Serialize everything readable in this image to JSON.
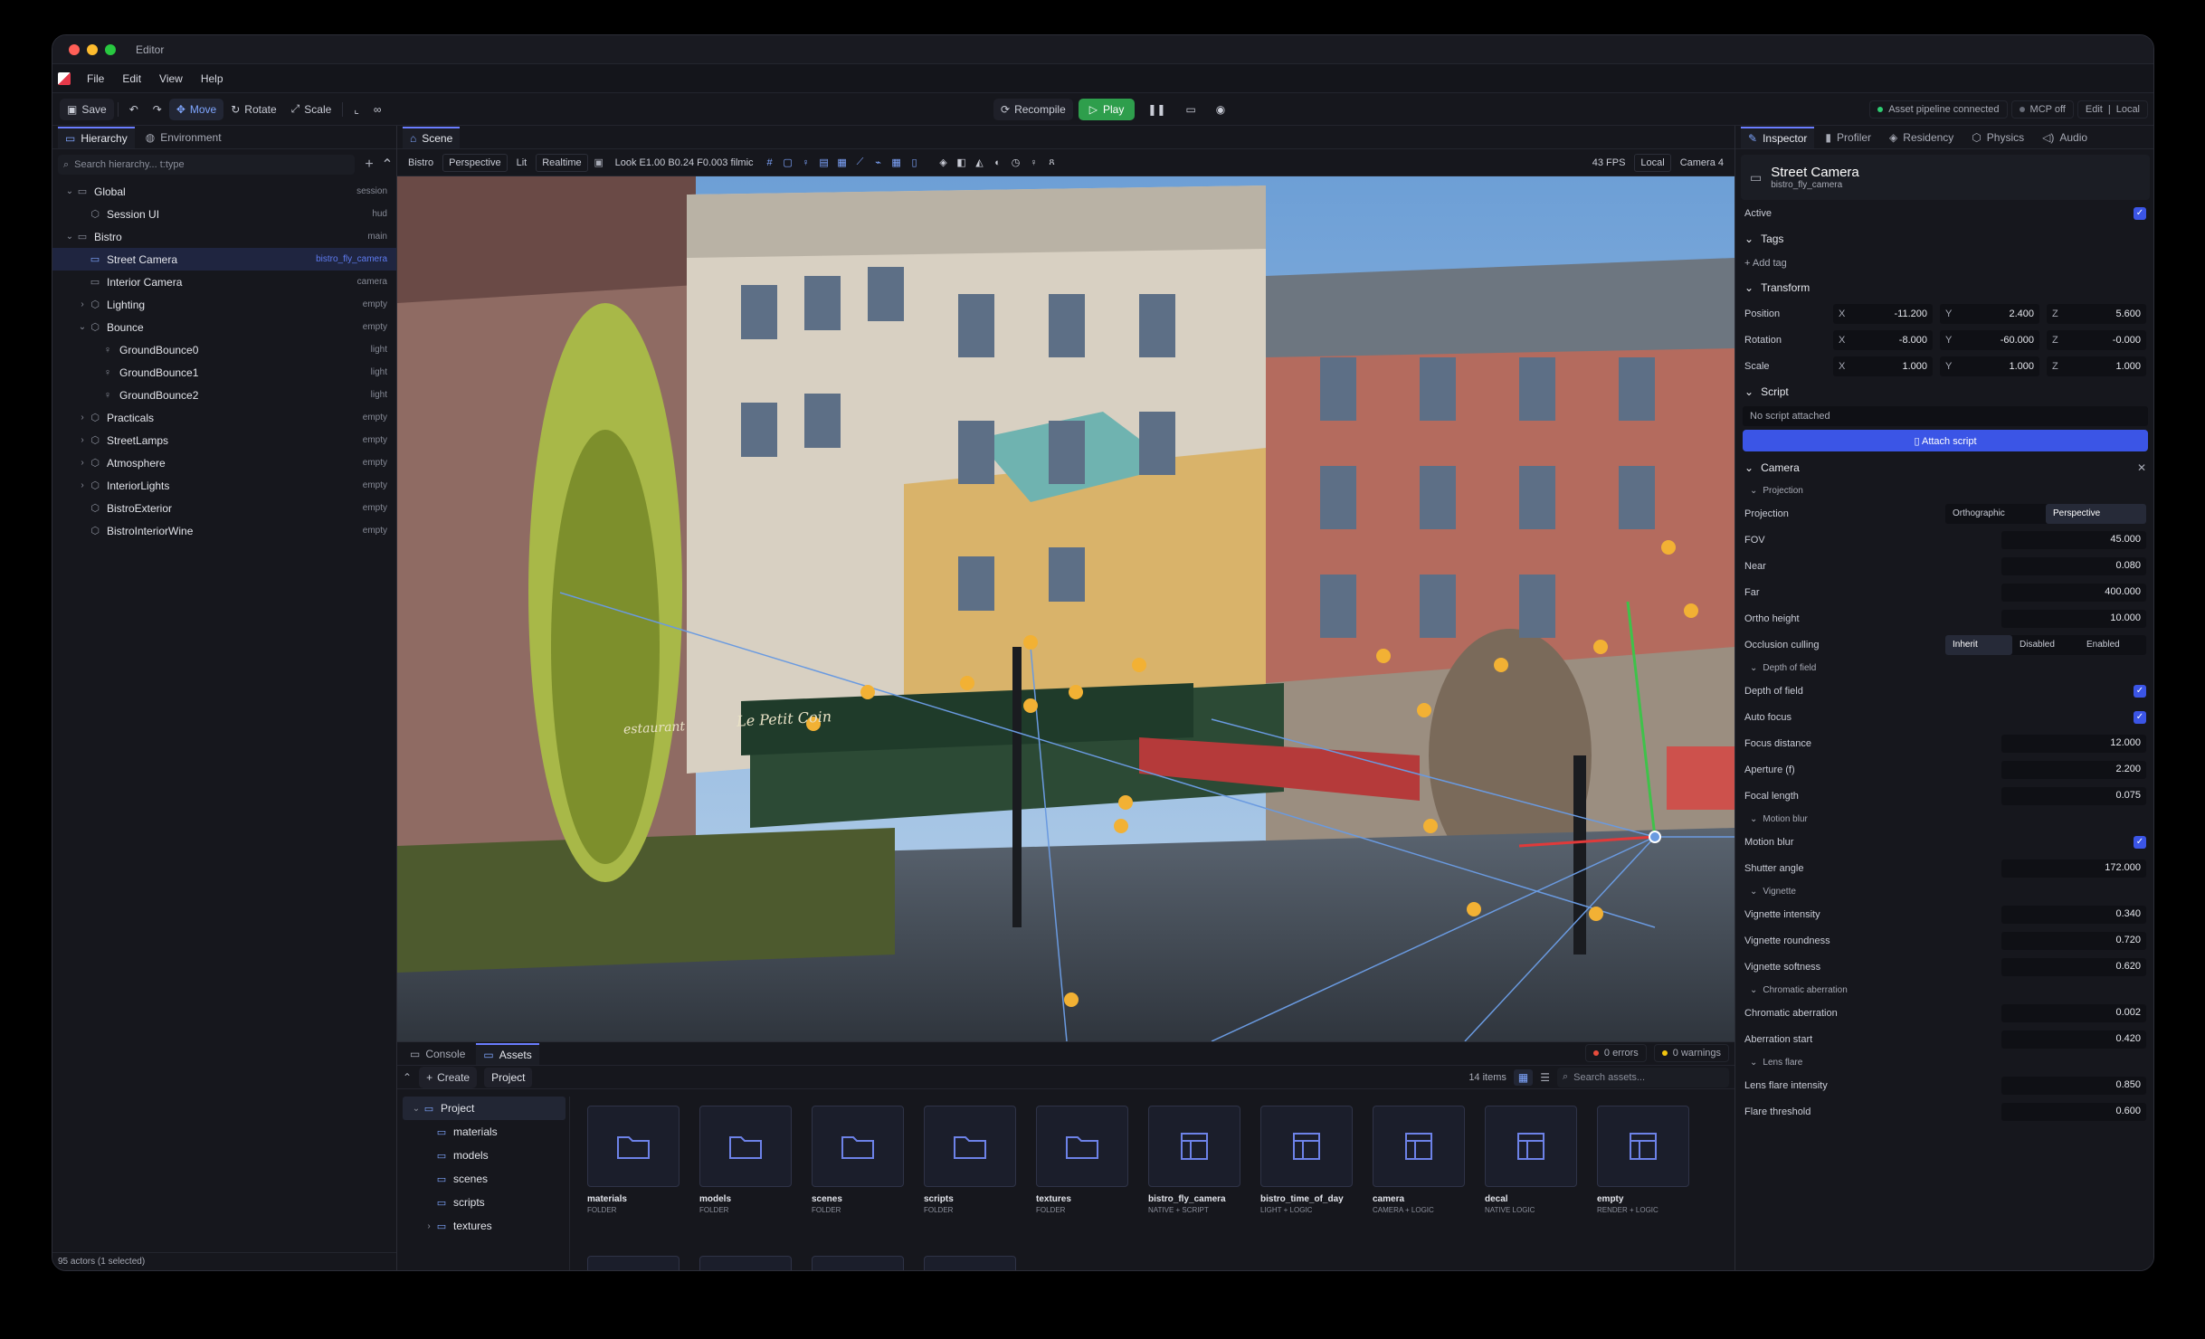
{
  "window": {
    "title": "Editor"
  },
  "menu": [
    "File",
    "Edit",
    "View",
    "Help"
  ],
  "toolbar": {
    "save": "Save",
    "move": "Move",
    "rotate": "Rotate",
    "scale": "Scale",
    "recompile": "Recompile",
    "play": "Play",
    "status_pipeline": "Asset pipeline connected",
    "status_mcp": "MCP off",
    "mode_edit": "Edit",
    "mode_local": "Local"
  },
  "hierarchy": {
    "tabs": [
      "Hierarchy",
      "Environment"
    ],
    "search_placeholder": "Search hierarchy... t:type",
    "rows": [
      {
        "name": "Global",
        "kind": "session"
      },
      {
        "name": "Session UI",
        "kind": "hud"
      },
      {
        "name": "Bistro",
        "kind": "main"
      },
      {
        "name": "Street Camera",
        "kind": "bistro_fly_camera"
      },
      {
        "name": "Interior Camera",
        "kind": "camera"
      },
      {
        "name": "Lighting",
        "kind": "empty"
      },
      {
        "name": "Bounce",
        "kind": "empty"
      },
      {
        "name": "GroundBounce0",
        "kind": "light"
      },
      {
        "name": "GroundBounce1",
        "kind": "light"
      },
      {
        "name": "GroundBounce2",
        "kind": "light"
      },
      {
        "name": "Practicals",
        "kind": "empty"
      },
      {
        "name": "StreetLamps",
        "kind": "empty"
      },
      {
        "name": "Atmosphere",
        "kind": "empty"
      },
      {
        "name": "InteriorLights",
        "kind": "empty"
      },
      {
        "name": "BistroExterior",
        "kind": "empty"
      },
      {
        "name": "BistroInteriorWine",
        "kind": "empty"
      }
    ],
    "status": "95 actors (1 selected)"
  },
  "scene": {
    "tab": "Scene",
    "bar": [
      "Bistro",
      "Perspective",
      "Lit",
      "Realtime"
    ],
    "look": "Look E1.00 B0.24 F0.003 filmic",
    "fps": "43 FPS",
    "space": "Local",
    "camera": "Camera 4",
    "sign": "Le Petit Coin",
    "sign2": "estaurant"
  },
  "bottom": {
    "tabs": [
      "Console",
      "Assets"
    ],
    "errors": "0 errors",
    "warnings": "0 warnings",
    "create": "Create",
    "breadcrumb": "Project",
    "count": "14 items",
    "search_placeholder": "Search assets...",
    "tree": [
      "Project",
      "materials",
      "models",
      "scenes",
      "scripts",
      "textures"
    ],
    "assets": [
      {
        "name": "materials",
        "kind": "FOLDER",
        "icon": "folder-icon"
      },
      {
        "name": "models",
        "kind": "FOLDER",
        "icon": "folder-icon"
      },
      {
        "name": "scenes",
        "kind": "FOLDER",
        "icon": "folder-icon"
      },
      {
        "name": "scripts",
        "kind": "FOLDER",
        "icon": "folder-icon"
      },
      {
        "name": "textures",
        "kind": "FOLDER",
        "icon": "folder-icon"
      },
      {
        "name": "bistro_fly_camera",
        "kind": "NATIVE + SCRIPT",
        "icon": "template-icon"
      },
      {
        "name": "bistro_time_of_day",
        "kind": "LIGHT + LOGIC",
        "icon": "template-icon"
      },
      {
        "name": "camera",
        "kind": "CAMERA + LOGIC",
        "icon": "template-icon"
      },
      {
        "name": "decal",
        "kind": "NATIVE LOGIC",
        "icon": "template-icon"
      },
      {
        "name": "empty",
        "kind": "RENDER + LOGIC",
        "icon": "template-icon"
      }
    ]
  },
  "inspector": {
    "tabs": [
      "Inspector",
      "Profiler",
      "Residency",
      "Physics",
      "Audio"
    ],
    "name": "Street Camera",
    "type": "bistro_fly_camera",
    "active": "Active",
    "tags": "Tags",
    "add_tag": "+ Add tag",
    "transform": "Transform",
    "position": {
      "label": "Position",
      "x": "-11.200",
      "y": "2.400",
      "z": "5.600"
    },
    "rotation": {
      "label": "Rotation",
      "x": "-8.000",
      "y": "-60.000",
      "z": "-0.000"
    },
    "scale": {
      "label": "Scale",
      "x": "1.000",
      "y": "1.000",
      "z": "1.000"
    },
    "script": "Script",
    "no_script": "No script attached",
    "attach": "Attach script",
    "camera": "Camera",
    "projection_group": "Projection",
    "projection": {
      "label": "Projection",
      "a": "Orthographic",
      "b": "Perspective"
    },
    "fov": {
      "label": "FOV",
      "value": "45.000"
    },
    "near": {
      "label": "Near",
      "value": "0.080"
    },
    "far": {
      "label": "Far",
      "value": "400.000"
    },
    "ortho": {
      "label": "Ortho height",
      "value": "10.000"
    },
    "occlusion": {
      "label": "Occlusion culling",
      "a": "Inherit",
      "b": "Disabled",
      "c": "Enabled"
    },
    "dof_group": "Depth of field",
    "dof": "Depth of field",
    "autofocus": "Auto focus",
    "focus_distance": {
      "label": "Focus distance",
      "value": "12.000"
    },
    "aperture": {
      "label": "Aperture (f)",
      "value": "2.200"
    },
    "focal_length": {
      "label": "Focal length",
      "value": "0.075"
    },
    "mb_group": "Motion blur",
    "motion_blur": "Motion blur",
    "shutter": {
      "label": "Shutter angle",
      "value": "172.000"
    },
    "vig_group": "Vignette",
    "vig_intensity": {
      "label": "Vignette intensity",
      "value": "0.340"
    },
    "vig_roundness": {
      "label": "Vignette roundness",
      "value": "0.720"
    },
    "vig_softness": {
      "label": "Vignette softness",
      "value": "0.620"
    },
    "ca_group": "Chromatic aberration",
    "ca": {
      "label": "Chromatic aberration",
      "value": "0.002"
    },
    "ab_start": {
      "label": "Aberration start",
      "value": "0.420"
    },
    "lf_group": "Lens flare",
    "lf_intensity": {
      "label": "Lens flare intensity",
      "value": "0.850"
    },
    "flare_threshold": {
      "label": "Flare threshold",
      "value": "0.600"
    }
  }
}
